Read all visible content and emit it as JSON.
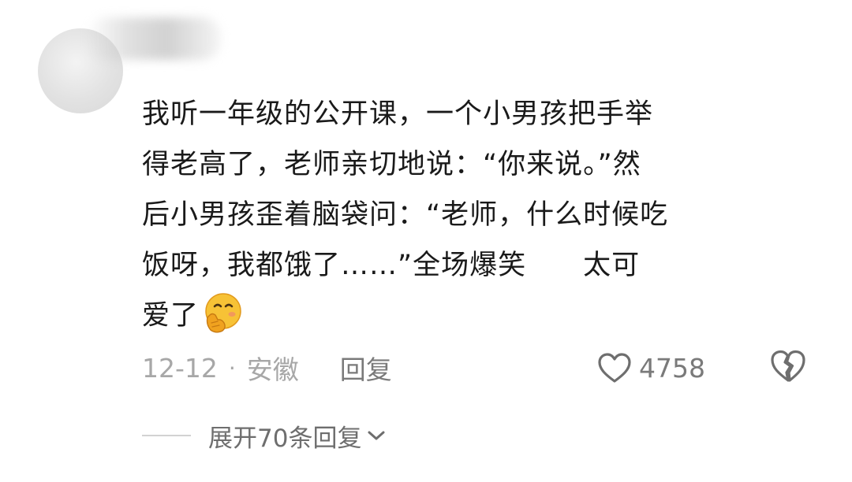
{
  "comment": {
    "lines": [
      "我听一年级的公开课，一个小男孩把手举",
      "得老高了，老师亲切地说：“你来说。”然",
      "后小男孩歪着脑袋问：“老师，什么时候吃",
      "饭呀，我都饿了……”全场爆笑　　太可",
      "爱了"
    ],
    "emoji": "face-with-hand-over-mouth-icon"
  },
  "meta": {
    "date": "12-12",
    "separator": "·",
    "location": "安徽",
    "reply_label": "回复"
  },
  "like": {
    "count": "4758",
    "icon": "heart-outline-icon"
  },
  "dislike": {
    "icon": "broken-heart-icon"
  },
  "expand": {
    "label": "展开70条回复",
    "icon": "chevron-down-icon"
  },
  "colors": {
    "text": "#1a1a1a",
    "meta": "#a7a7a7",
    "secondary": "#7a7a7a",
    "emoji_yellow": "#f5b82e"
  }
}
